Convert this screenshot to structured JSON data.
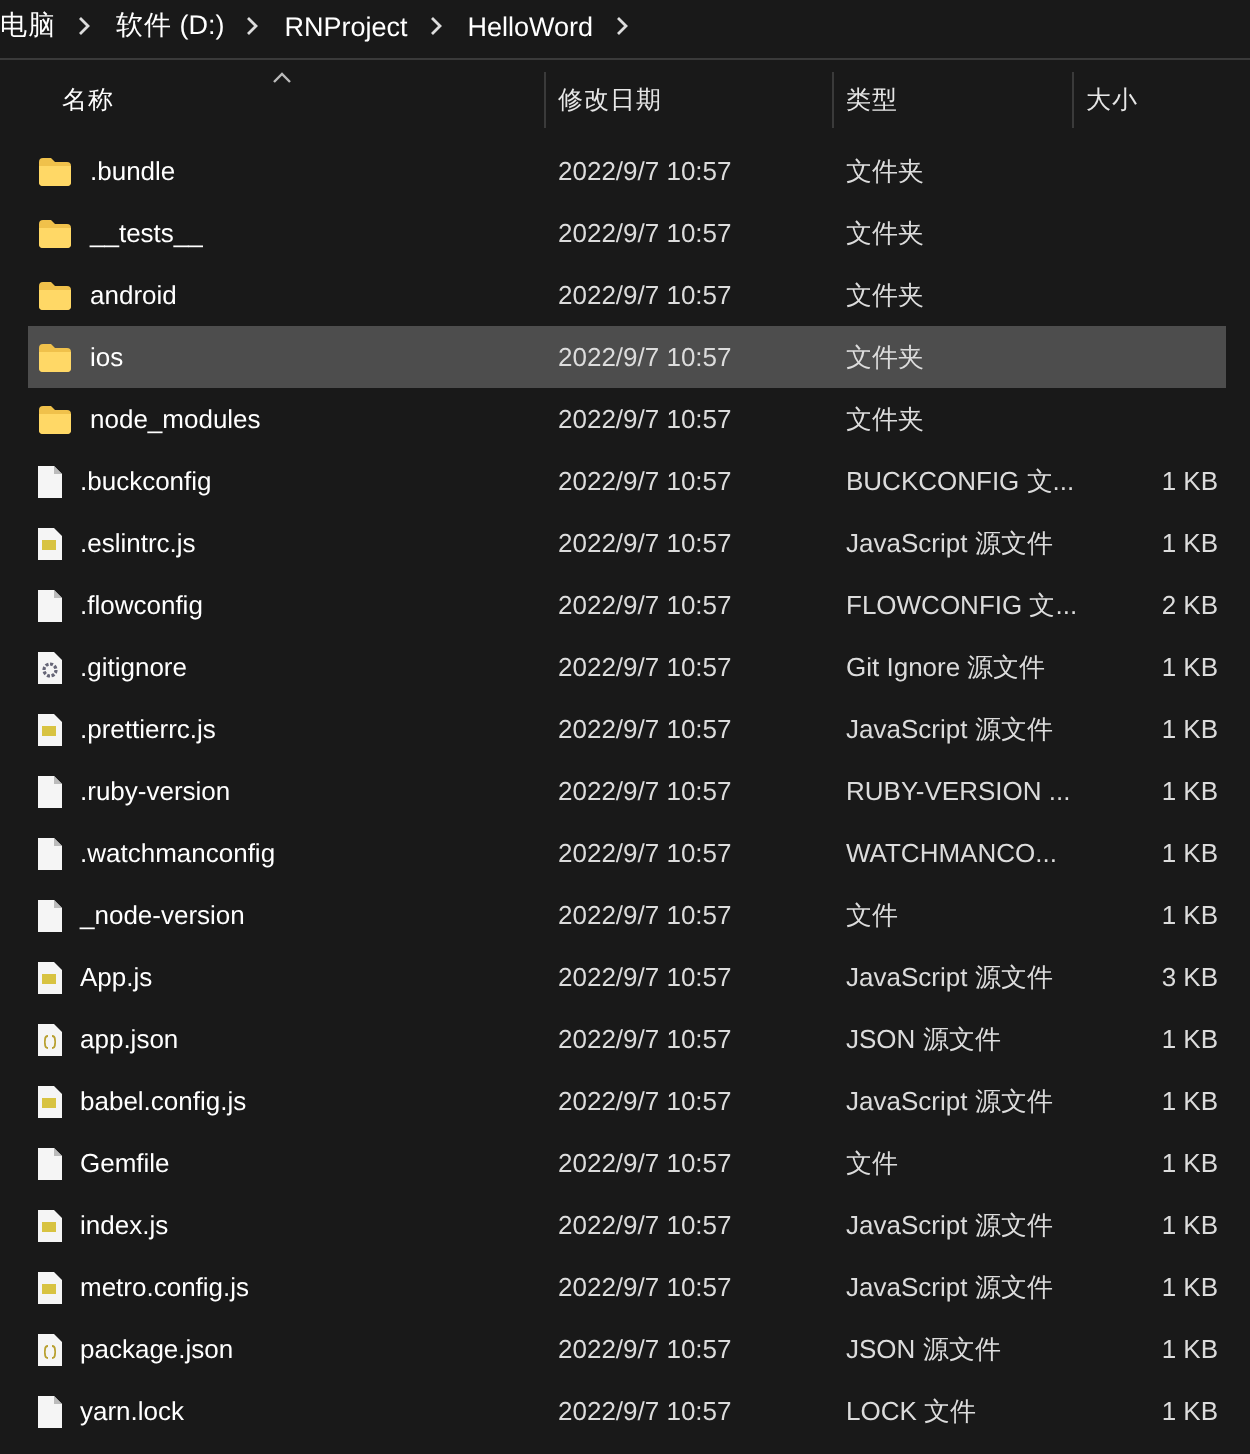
{
  "breadcrumb": [
    "电脑",
    "软件 (D:)",
    "RNProject",
    "HelloWord"
  ],
  "columns": [
    {
      "label": "名称",
      "sorted": true
    },
    {
      "label": "修改日期",
      "sorted": false
    },
    {
      "label": "类型",
      "sorted": false
    },
    {
      "label": "大小",
      "sorted": false
    }
  ],
  "rows": [
    {
      "kind": "folder",
      "name": ".bundle",
      "date": "2022/9/7 10:57",
      "type": "文件夹",
      "selected": false
    },
    {
      "kind": "folder",
      "name": "__tests__",
      "date": "2022/9/7 10:57",
      "type": "文件夹",
      "selected": false
    },
    {
      "kind": "folder",
      "name": "android",
      "date": "2022/9/7 10:57",
      "type": "文件夹",
      "selected": false
    },
    {
      "kind": "folder",
      "name": "ios",
      "date": "2022/9/7 10:57",
      "type": "文件夹",
      "selected": true
    },
    {
      "kind": "folder",
      "name": "node_modules",
      "date": "2022/9/7 10:57",
      "type": "文件夹",
      "selected": false
    },
    {
      "kind": "file",
      "name": ".buckconfig",
      "date": "2022/9/7 10:57",
      "type": "BUCKCONFIG 文...",
      "size": "1 KB",
      "selected": false
    },
    {
      "kind": "js",
      "name": ".eslintrc.js",
      "date": "2022/9/7 10:57",
      "type": "JavaScript 源文件",
      "size": "1 KB",
      "selected": false
    },
    {
      "kind": "file",
      "name": ".flowconfig",
      "date": "2022/9/7 10:57",
      "type": "FLOWCONFIG 文...",
      "size": "2 KB",
      "selected": false
    },
    {
      "kind": "settings",
      "name": ".gitignore",
      "date": "2022/9/7 10:57",
      "type": "Git Ignore 源文件",
      "size": "1 KB",
      "selected": false
    },
    {
      "kind": "js",
      "name": ".prettierrc.js",
      "date": "2022/9/7 10:57",
      "type": "JavaScript 源文件",
      "size": "1 KB",
      "selected": false
    },
    {
      "kind": "file",
      "name": ".ruby-version",
      "date": "2022/9/7 10:57",
      "type": "RUBY-VERSION ...",
      "size": "1 KB",
      "selected": false
    },
    {
      "kind": "file",
      "name": ".watchmanconfig",
      "date": "2022/9/7 10:57",
      "type": "WATCHMANCO...",
      "size": "1 KB",
      "selected": false
    },
    {
      "kind": "file",
      "name": "_node-version",
      "date": "2022/9/7 10:57",
      "type": "文件",
      "size": "1 KB",
      "selected": false
    },
    {
      "kind": "js",
      "name": "App.js",
      "date": "2022/9/7 10:57",
      "type": "JavaScript 源文件",
      "size": "3 KB",
      "selected": false
    },
    {
      "kind": "json",
      "name": "app.json",
      "date": "2022/9/7 10:57",
      "type": "JSON 源文件",
      "size": "1 KB",
      "selected": false
    },
    {
      "kind": "js",
      "name": "babel.config.js",
      "date": "2022/9/7 10:57",
      "type": "JavaScript 源文件",
      "size": "1 KB",
      "selected": false
    },
    {
      "kind": "file",
      "name": "Gemfile",
      "date": "2022/9/7 10:57",
      "type": "文件",
      "size": "1 KB",
      "selected": false
    },
    {
      "kind": "js",
      "name": "index.js",
      "date": "2022/9/7 10:57",
      "type": "JavaScript 源文件",
      "size": "1 KB",
      "selected": false
    },
    {
      "kind": "js",
      "name": "metro.config.js",
      "date": "2022/9/7 10:57",
      "type": "JavaScript 源文件",
      "size": "1 KB",
      "selected": false
    },
    {
      "kind": "json",
      "name": "package.json",
      "date": "2022/9/7 10:57",
      "type": "JSON 源文件",
      "size": "1 KB",
      "selected": false
    },
    {
      "kind": "file",
      "name": "yarn.lock",
      "date": "2022/9/7 10:57",
      "type": "LOCK 文件",
      "size": "1 KB",
      "selected": false
    }
  ]
}
